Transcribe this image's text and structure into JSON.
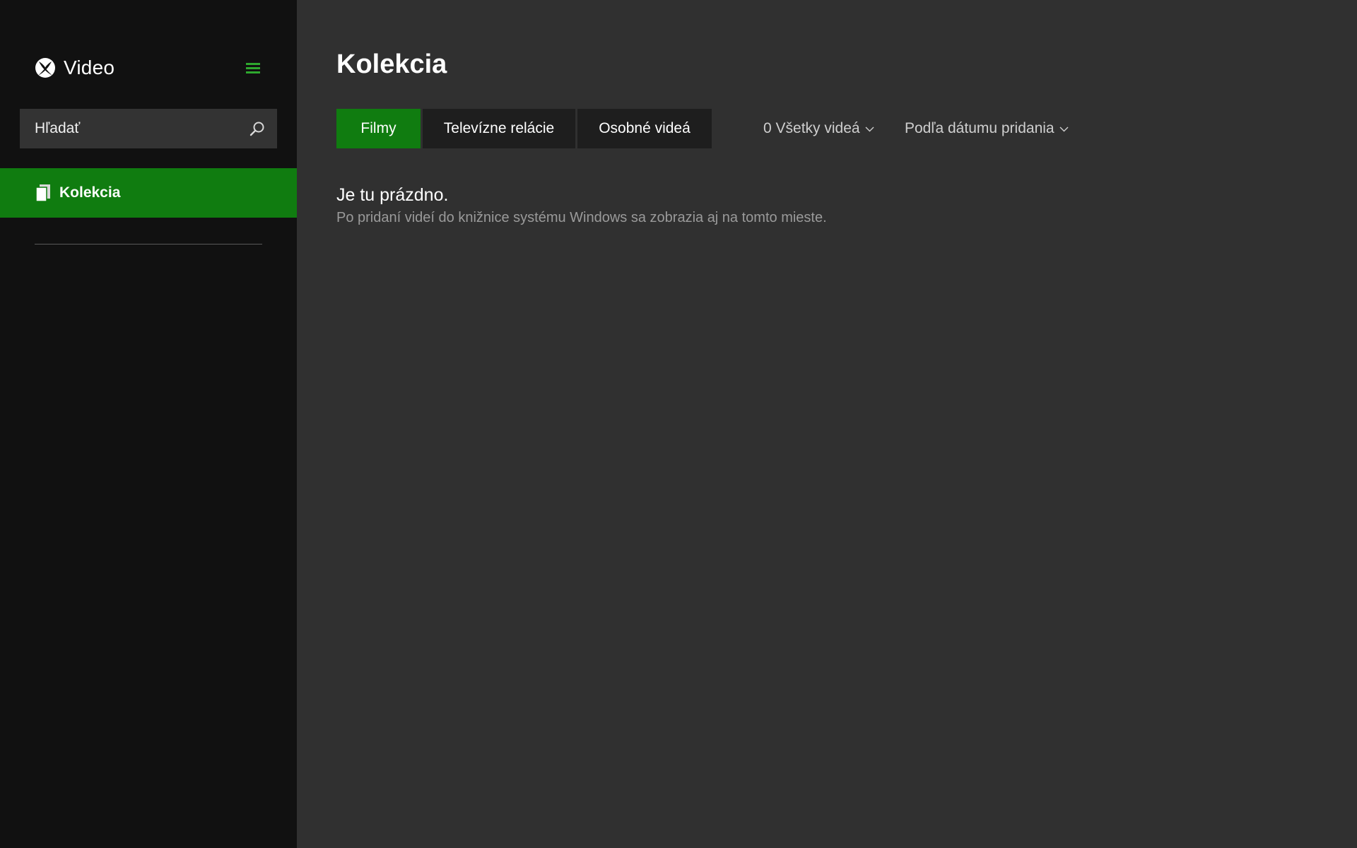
{
  "app": {
    "name": "Video",
    "logo_icon": "xbox-logo-icon",
    "accent_color": "#107c10",
    "menu_icon": "hamburger-menu-icon"
  },
  "sidebar": {
    "search": {
      "placeholder": "Hľadať",
      "icon": "search-icon"
    },
    "items": [
      {
        "label": "Kolekcia",
        "icon": "collection-icon",
        "selected": true
      }
    ]
  },
  "main": {
    "title": "Kolekcia",
    "tabs": [
      {
        "label": "Filmy",
        "active": true
      },
      {
        "label": "Televízne relácie",
        "active": false
      },
      {
        "label": "Osobné videá",
        "active": false
      }
    ],
    "filters": {
      "scope": "0 Všetky videá",
      "sort": "Podľa dátumu pridania"
    },
    "empty_state": {
      "title": "Je tu prázdno.",
      "description": "Po pridaní videí do knižnice systému Windows sa zobrazia aj na tomto mieste."
    }
  }
}
